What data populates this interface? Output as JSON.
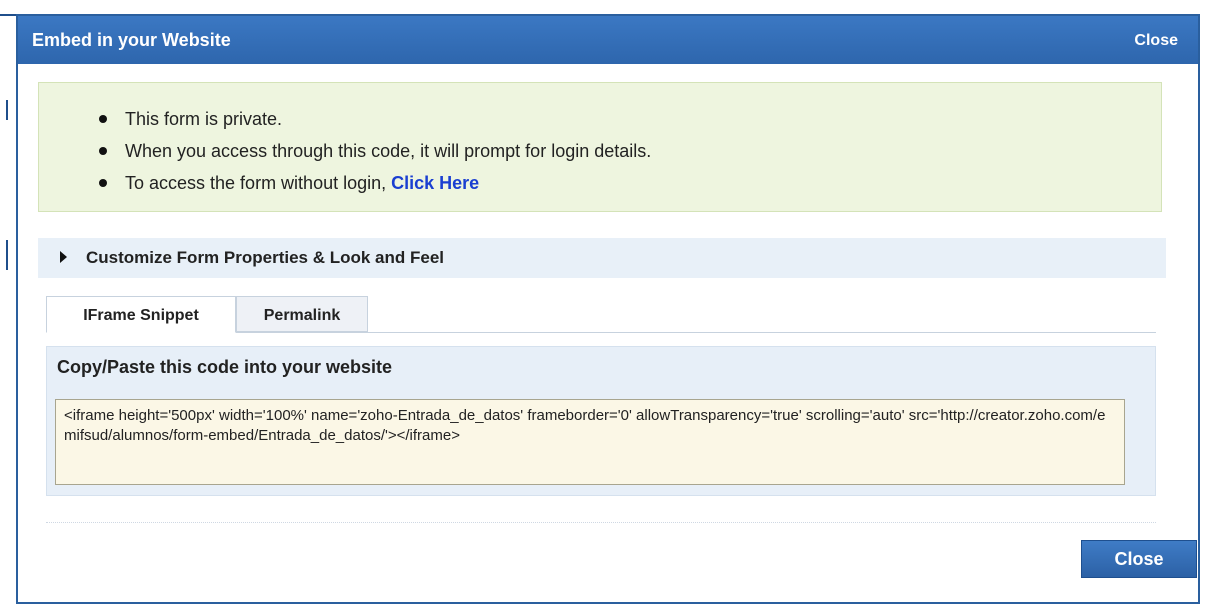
{
  "dialog": {
    "title": "Embed in your Website",
    "close_link": "Close"
  },
  "notice": {
    "items": [
      "This form is private.",
      "When you access through this code, it will prompt for login details.",
      "To access the form without login, "
    ],
    "link_text": "Click Here"
  },
  "customize": {
    "label": "Customize Form Properties & Look and Feel"
  },
  "tabs": [
    {
      "label": "IFrame Snippet",
      "active": true
    },
    {
      "label": "Permalink",
      "active": false
    }
  ],
  "code_panel": {
    "heading": "Copy/Paste this code into your website",
    "code": "<iframe height='500px' width='100%' name='zoho-Entrada_de_datos' frameborder='0' allowTransparency='true' scrolling='auto' src='http://creator.zoho.com/emifsud/alumnos/form-embed/Entrada_de_datos/'></iframe>"
  },
  "footer": {
    "close_button": "Close"
  },
  "colors": {
    "titlebar": "#2e66ad",
    "notice_bg": "#eef5df",
    "link": "#1a3fd1",
    "code_bg": "#fbf7e6"
  }
}
